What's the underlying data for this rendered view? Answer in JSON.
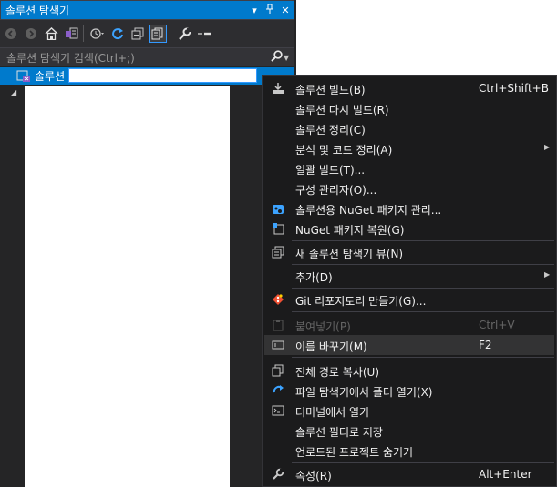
{
  "panel": {
    "title": "솔루션 탐색기",
    "title_icons": [
      "chevron-down-icon",
      "pin-icon",
      "close-icon"
    ],
    "search_placeholder": "솔루션 탐색기 검색(Ctrl+;)",
    "tree": {
      "root_label": "솔루션",
      "rename_value": ""
    }
  },
  "menu": {
    "items": [
      {
        "label": "솔루션 빌드(B)",
        "shortcut": "Ctrl+Shift+B",
        "icon": "build-icon"
      },
      {
        "label": "솔루션 다시 빌드(R)",
        "shortcut": ""
      },
      {
        "label": "솔루션 정리(C)",
        "shortcut": ""
      },
      {
        "label": "분석 및 코드 정리(A)",
        "shortcut": "",
        "submenu": true
      },
      {
        "label": "일괄 빌드(T)...",
        "shortcut": ""
      },
      {
        "label": "구성 관리자(O)...",
        "shortcut": ""
      },
      {
        "label": "솔루션용 NuGet 패키지 관리...",
        "shortcut": "",
        "icon": "nuget-icon"
      },
      {
        "label": "NuGet 패키지 복원(G)",
        "shortcut": "",
        "icon": "nuget-restore-icon"
      },
      {
        "label": "새 솔루션 탐색기 뷰(N)",
        "shortcut": "",
        "icon": "new-view-icon"
      },
      {
        "label": "추가(D)",
        "shortcut": "",
        "submenu": true
      },
      {
        "label": "Git 리포지토리 만들기(G)...",
        "shortcut": "",
        "icon": "git-icon"
      },
      {
        "label": "붙여넣기(P)",
        "shortcut": "Ctrl+V",
        "icon": "paste-icon",
        "disabled": true
      },
      {
        "label": "이름 바꾸기(M)",
        "shortcut": "F2",
        "icon": "rename-icon",
        "highlighted": true
      },
      {
        "label": "전체 경로 복사(U)",
        "shortcut": "",
        "icon": "copy-icon"
      },
      {
        "label": "파일 탐색기에서 폴더 열기(X)",
        "shortcut": "",
        "icon": "open-folder-icon"
      },
      {
        "label": "터미널에서 열기",
        "shortcut": "",
        "icon": "terminal-icon"
      },
      {
        "label": "솔루션 필터로 저장",
        "shortcut": ""
      },
      {
        "label": "언로드된 프로젝트 숨기기",
        "shortcut": ""
      },
      {
        "label": "속성(R)",
        "shortcut": "Alt+Enter",
        "icon": "wrench-icon"
      }
    ]
  },
  "colors": {
    "accent": "#007acc",
    "panel_bg": "#252526",
    "menu_bg": "#1b1b1c"
  }
}
